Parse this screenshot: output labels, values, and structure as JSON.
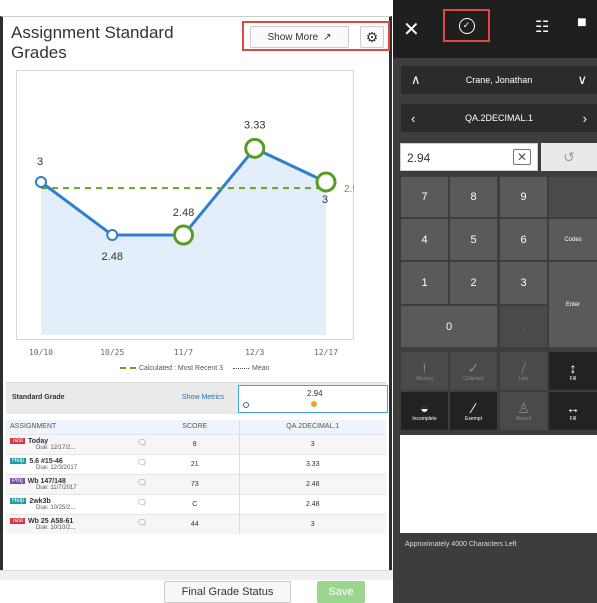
{
  "card": {
    "title": "Assignment Standard Grades",
    "show_more_label": "Show More",
    "show_more_icon": "external-link-icon",
    "settings_icon": "gear-icon"
  },
  "chart_data": {
    "type": "line",
    "x": [
      "10/10",
      "10/25",
      "11/7",
      "12/3",
      "12/17"
    ],
    "series": [
      {
        "points": [
          {
            "x": "10/10",
            "y": 3
          },
          {
            "x": "10/25",
            "y": 2.48
          },
          {
            "x": "11/7",
            "y": 2.48
          },
          {
            "x": "12/3",
            "y": 3.33
          },
          {
            "x": "12/17",
            "y": 3
          }
        ],
        "calculated_points": [
          2,
          3,
          4
        ]
      }
    ],
    "mean": 2.94,
    "mean_label": "2.94",
    "point_labels": [
      "3",
      "2.48",
      "2.48",
      "3.33",
      "3"
    ],
    "ylim": [
      1.5,
      4.0
    ],
    "colors": {
      "line": "#2f7fd0",
      "fill": "#e3eefa",
      "calculated": "#5b9a23",
      "mean": "#6aa329"
    }
  },
  "legend": {
    "calculated": "Calculated : Most Recent 3",
    "mean": "Mean"
  },
  "standard_grade": {
    "label": "Standard Grade",
    "metrics_link": "Show Metrics",
    "value": "2.94"
  },
  "table": {
    "headers": {
      "assignment": "ASSIGNMENT",
      "score": "SCORE",
      "standard": "QA.2DECIMAL.1"
    },
    "rows": [
      {
        "tag": "Test",
        "tag_color": "red",
        "name": "Today",
        "due": "Due: 12/17/2...",
        "score": "8",
        "standard": "3"
      },
      {
        "tag": "Help",
        "tag_color": "teal",
        "name": "5.6 #15-46",
        "due": "Due: 12/3/2017",
        "score": "21",
        "standard": "3.33"
      },
      {
        "tag": "Proj",
        "tag_color": "purple",
        "name": "Wb 147/148",
        "due": "Due: 11/7/2017",
        "score": "73",
        "standard": "2.48"
      },
      {
        "tag": "Help",
        "tag_color": "teal",
        "name": "2wk3b",
        "due": "Due: 10/25/2...",
        "score": "C",
        "standard": "2.48"
      },
      {
        "tag": "Test",
        "tag_color": "red",
        "name": "Wb 25 A58-61",
        "due": "Due: 10/10/2...",
        "score": "44",
        "standard": "3"
      }
    ]
  },
  "footer": {
    "final_grade_status": "Final Grade Status",
    "save": "Save"
  },
  "panel": {
    "student": "Crane, Jonathan",
    "standard": "QA.2DECIMAL.1",
    "input_value": "2.94",
    "keys": [
      "7",
      "8",
      "9",
      "4",
      "5",
      "6",
      "1",
      "2",
      "3",
      "0",
      "."
    ],
    "codes_label": "Codes",
    "enter_label": "Enter",
    "tools": [
      {
        "label": "Missing",
        "icon": "exclamation-icon"
      },
      {
        "label": "Collected",
        "icon": "check-icon"
      },
      {
        "label": "Late",
        "icon": "late-icon"
      },
      {
        "label": "Fill",
        "icon": "fill-vertical-icon"
      },
      {
        "label": "Incomplete",
        "icon": "incomplete-icon"
      },
      {
        "label": "Exempt",
        "icon": "exempt-icon"
      },
      {
        "label": "Absent",
        "icon": "absent-icon"
      },
      {
        "label": "Fill",
        "icon": "fill-horizontal-icon"
      }
    ],
    "chars_left": "Approximately 4000 Characters Left"
  }
}
